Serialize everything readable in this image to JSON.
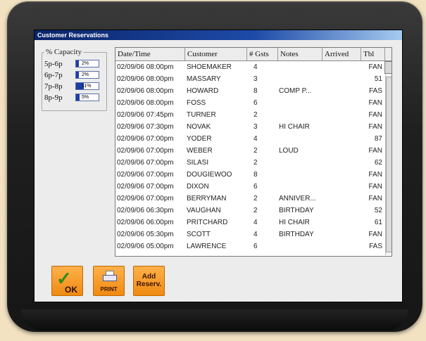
{
  "window": {
    "title": "Customer Reservations"
  },
  "capacity": {
    "legend": "% Capacity",
    "slots": [
      {
        "label": "5p-6p",
        "value": "2%",
        "fill": 0.02
      },
      {
        "label": "6p-7p",
        "value": "2%",
        "fill": 0.02
      },
      {
        "label": "7p-8p",
        "value": "11%",
        "fill": 0.11
      },
      {
        "label": "8p-9p",
        "value": "5%",
        "fill": 0.05
      }
    ]
  },
  "table": {
    "headers": {
      "datetime": "Date/Time",
      "customer": "Customer",
      "gsts": "# Gsts",
      "notes": "Notes",
      "arrived": "Arrived",
      "tbl": "Tbl"
    },
    "rows": [
      {
        "datetime": "02/09/06 08:00pm",
        "customer": "SHOEMAKER",
        "gsts": "4",
        "notes": "",
        "tbl": "FAN"
      },
      {
        "datetime": "02/09/06 08:00pm",
        "customer": "MASSARY",
        "gsts": "3",
        "notes": "",
        "tbl": "51"
      },
      {
        "datetime": "02/09/06 08:00pm",
        "customer": "HOWARD",
        "gsts": "8",
        "notes": "COMP P...",
        "tbl": "FAS"
      },
      {
        "datetime": "02/09/06 08:00pm",
        "customer": "FOSS",
        "gsts": "6",
        "notes": "",
        "tbl": "FAN"
      },
      {
        "datetime": "02/09/06 07:45pm",
        "customer": "TURNER",
        "gsts": "2",
        "notes": "",
        "tbl": "FAN"
      },
      {
        "datetime": "02/09/06 07:30pm",
        "customer": "NOVAK",
        "gsts": "3",
        "notes": "HI CHAIR",
        "tbl": "FAN"
      },
      {
        "datetime": "02/09/06 07:00pm",
        "customer": "YODER",
        "gsts": "4",
        "notes": "",
        "tbl": "87"
      },
      {
        "datetime": "02/09/06 07:00pm",
        "customer": "WEBER",
        "gsts": "2",
        "notes": "LOUD",
        "tbl": "FAN"
      },
      {
        "datetime": "02/09/06 07:00pm",
        "customer": "SILASI",
        "gsts": "2",
        "notes": "",
        "tbl": "62"
      },
      {
        "datetime": "02/09/06 07:00pm",
        "customer": "DOUGIEWOO",
        "gsts": "8",
        "notes": "",
        "tbl": "FAN"
      },
      {
        "datetime": "02/09/06 07:00pm",
        "customer": "DIXON",
        "gsts": "6",
        "notes": "",
        "tbl": "FAN"
      },
      {
        "datetime": "02/09/06 07:00pm",
        "customer": "BERRYMAN",
        "gsts": "2",
        "notes": "ANNIVER...",
        "tbl": "FAN"
      },
      {
        "datetime": "02/09/06 06:30pm",
        "customer": "VAUGHAN",
        "gsts": "2",
        "notes": "BIRTHDAY",
        "tbl": "52"
      },
      {
        "datetime": "02/09/06 06:00pm",
        "customer": "PRITCHARD",
        "gsts": "4",
        "notes": "HI CHAIR",
        "tbl": "61"
      },
      {
        "datetime": "02/09/06 05:30pm",
        "customer": "SCOTT",
        "gsts": "4",
        "notes": "BIRTHDAY",
        "tbl": "FAN"
      },
      {
        "datetime": "02/09/06 05:00pm",
        "customer": "LAWRENCE",
        "gsts": "6",
        "notes": "",
        "tbl": "FAS"
      }
    ]
  },
  "buttons": {
    "ok": {
      "label": "OK",
      "icon": "checkmark-icon"
    },
    "print": {
      "label": "PRINT",
      "icon": "printer-icon"
    },
    "add": {
      "label": "Add Reserv."
    }
  }
}
